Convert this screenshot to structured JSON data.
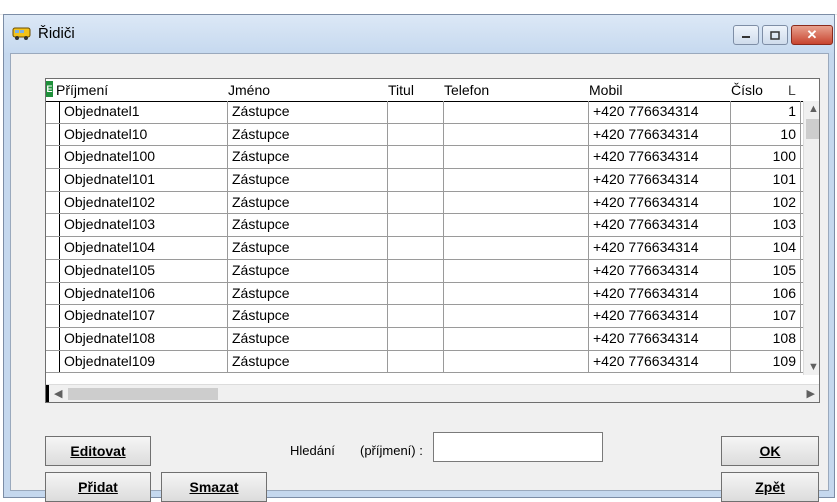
{
  "window": {
    "title": "Řidiči",
    "close_glyph": "✕"
  },
  "grid": {
    "columns": [
      "Příjmení",
      "Jméno",
      "Titul",
      "Telefon",
      "Mobil",
      "Číslo",
      "L"
    ],
    "rows": [
      {
        "prijmeni": "Objednatel1",
        "jmeno": "Zástupce",
        "titul": "",
        "telefon": "",
        "mobil": "+420 776634314",
        "cislo": "1"
      },
      {
        "prijmeni": "Objednatel10",
        "jmeno": "Zástupce",
        "titul": "",
        "telefon": "",
        "mobil": "+420 776634314",
        "cislo": "10"
      },
      {
        "prijmeni": "Objednatel100",
        "jmeno": "Zástupce",
        "titul": "",
        "telefon": "",
        "mobil": "+420 776634314",
        "cislo": "100"
      },
      {
        "prijmeni": "Objednatel101",
        "jmeno": "Zástupce",
        "titul": "",
        "telefon": "",
        "mobil": "+420 776634314",
        "cislo": "101"
      },
      {
        "prijmeni": "Objednatel102",
        "jmeno": "Zástupce",
        "titul": "",
        "telefon": "",
        "mobil": "+420 776634314",
        "cislo": "102"
      },
      {
        "prijmeni": "Objednatel103",
        "jmeno": "Zástupce",
        "titul": "",
        "telefon": "",
        "mobil": "+420 776634314",
        "cislo": "103"
      },
      {
        "prijmeni": "Objednatel104",
        "jmeno": "Zástupce",
        "titul": "",
        "telefon": "",
        "mobil": "+420 776634314",
        "cislo": "104"
      },
      {
        "prijmeni": "Objednatel105",
        "jmeno": "Zástupce",
        "titul": "",
        "telefon": "",
        "mobil": "+420 776634314",
        "cislo": "105"
      },
      {
        "prijmeni": "Objednatel106",
        "jmeno": "Zástupce",
        "titul": "",
        "telefon": "",
        "mobil": "+420 776634314",
        "cislo": "106"
      },
      {
        "prijmeni": "Objednatel107",
        "jmeno": "Zástupce",
        "titul": "",
        "telefon": "",
        "mobil": "+420 776634314",
        "cislo": "107"
      },
      {
        "prijmeni": "Objednatel108",
        "jmeno": "Zástupce",
        "titul": "",
        "telefon": "",
        "mobil": "+420 776634314",
        "cislo": "108"
      },
      {
        "prijmeni": "Objednatel109",
        "jmeno": "Zástupce",
        "titul": "",
        "telefon": "",
        "mobil": "+420 776634314",
        "cislo": "109"
      }
    ]
  },
  "buttons": {
    "edit": "Editovat",
    "add": "Přidat",
    "delete": "Smazat",
    "ok": "OK",
    "back": "Zpět"
  },
  "search": {
    "label": "Hledání",
    "hint": "(příjmení) :",
    "value": ""
  },
  "icons": {
    "app": "bus-icon"
  }
}
